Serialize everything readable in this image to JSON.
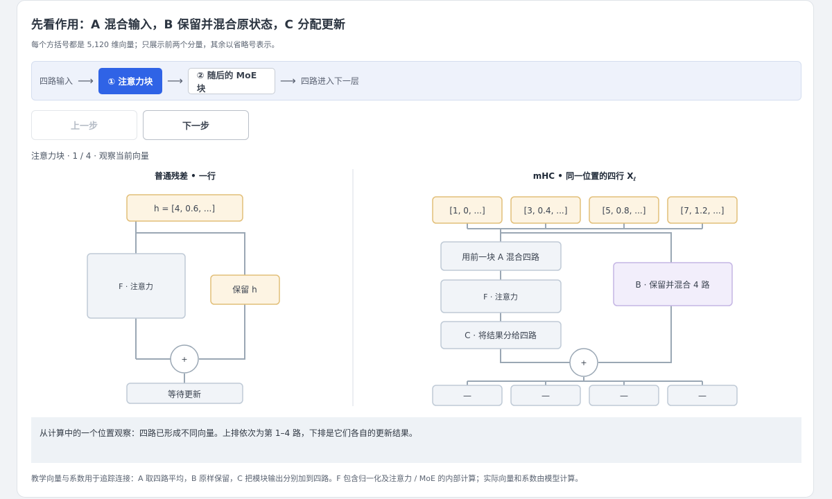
{
  "title": "先看作用：A 混合输入，B 保留并混合原状态，C 分配更新",
  "subtitle": "每个方括号都是 5,120 维向量；只展示前两个分量，其余以省略号表示。",
  "pipeline": {
    "input_label": "四路输入",
    "arrow": "⟶",
    "stage1": "① 注意力块",
    "stage2": "② 随后的 MoE 块",
    "output_label": "四路进入下一层"
  },
  "buttons": {
    "prev": "上一步",
    "next": "下一步"
  },
  "status": "注意力块 · 1 / 4 · 观察当前向量",
  "left_panel": {
    "heading": "普通残差 • 一行",
    "h_box": "h = [4, 0.6, ...]",
    "f_box": "F · 注意力",
    "keep_box": "保留 h",
    "plus": "+",
    "result": "等待更新"
  },
  "right_panel": {
    "heading": "mHC • 同一位置的四行 X",
    "heading_sub": "ℓ",
    "rows": [
      "[1, 0, ...]",
      "[3, 0.4, ...]",
      "[5, 0.8, ...]",
      "[7, 1.2, ...]"
    ],
    "a_box": "用前一块 A 混合四路",
    "f_box": "F · 注意力",
    "c_box": "C · 将结果分给四路",
    "b_box": "B · 保留并混合 4 路",
    "plus": "+",
    "outputs": [
      "—",
      "—",
      "—",
      "—"
    ]
  },
  "note": "从计算中的一个位置观察：四路已形成不同向量。上排依次为第 1–4 路，下排是它们各自的更新结果。",
  "footnote": "教学向量与系数用于追踪连接：A 取四路平均，B 原样保留，C 把模块输出分别加到四路。F 包含归一化及注意力 / MoE 的内部计算；实际向量和系数由模型计算。",
  "colors": {
    "accent": "#2f63e6",
    "warm_fill": "#fdf4e3",
    "warm_stroke": "#e2bf79",
    "neutral_fill": "#f1f4f8",
    "neutral_stroke": "#bfcad6",
    "purple_fill": "#f2eefb",
    "purple_stroke": "#c4b5e4",
    "line": "#9aa7b4"
  }
}
